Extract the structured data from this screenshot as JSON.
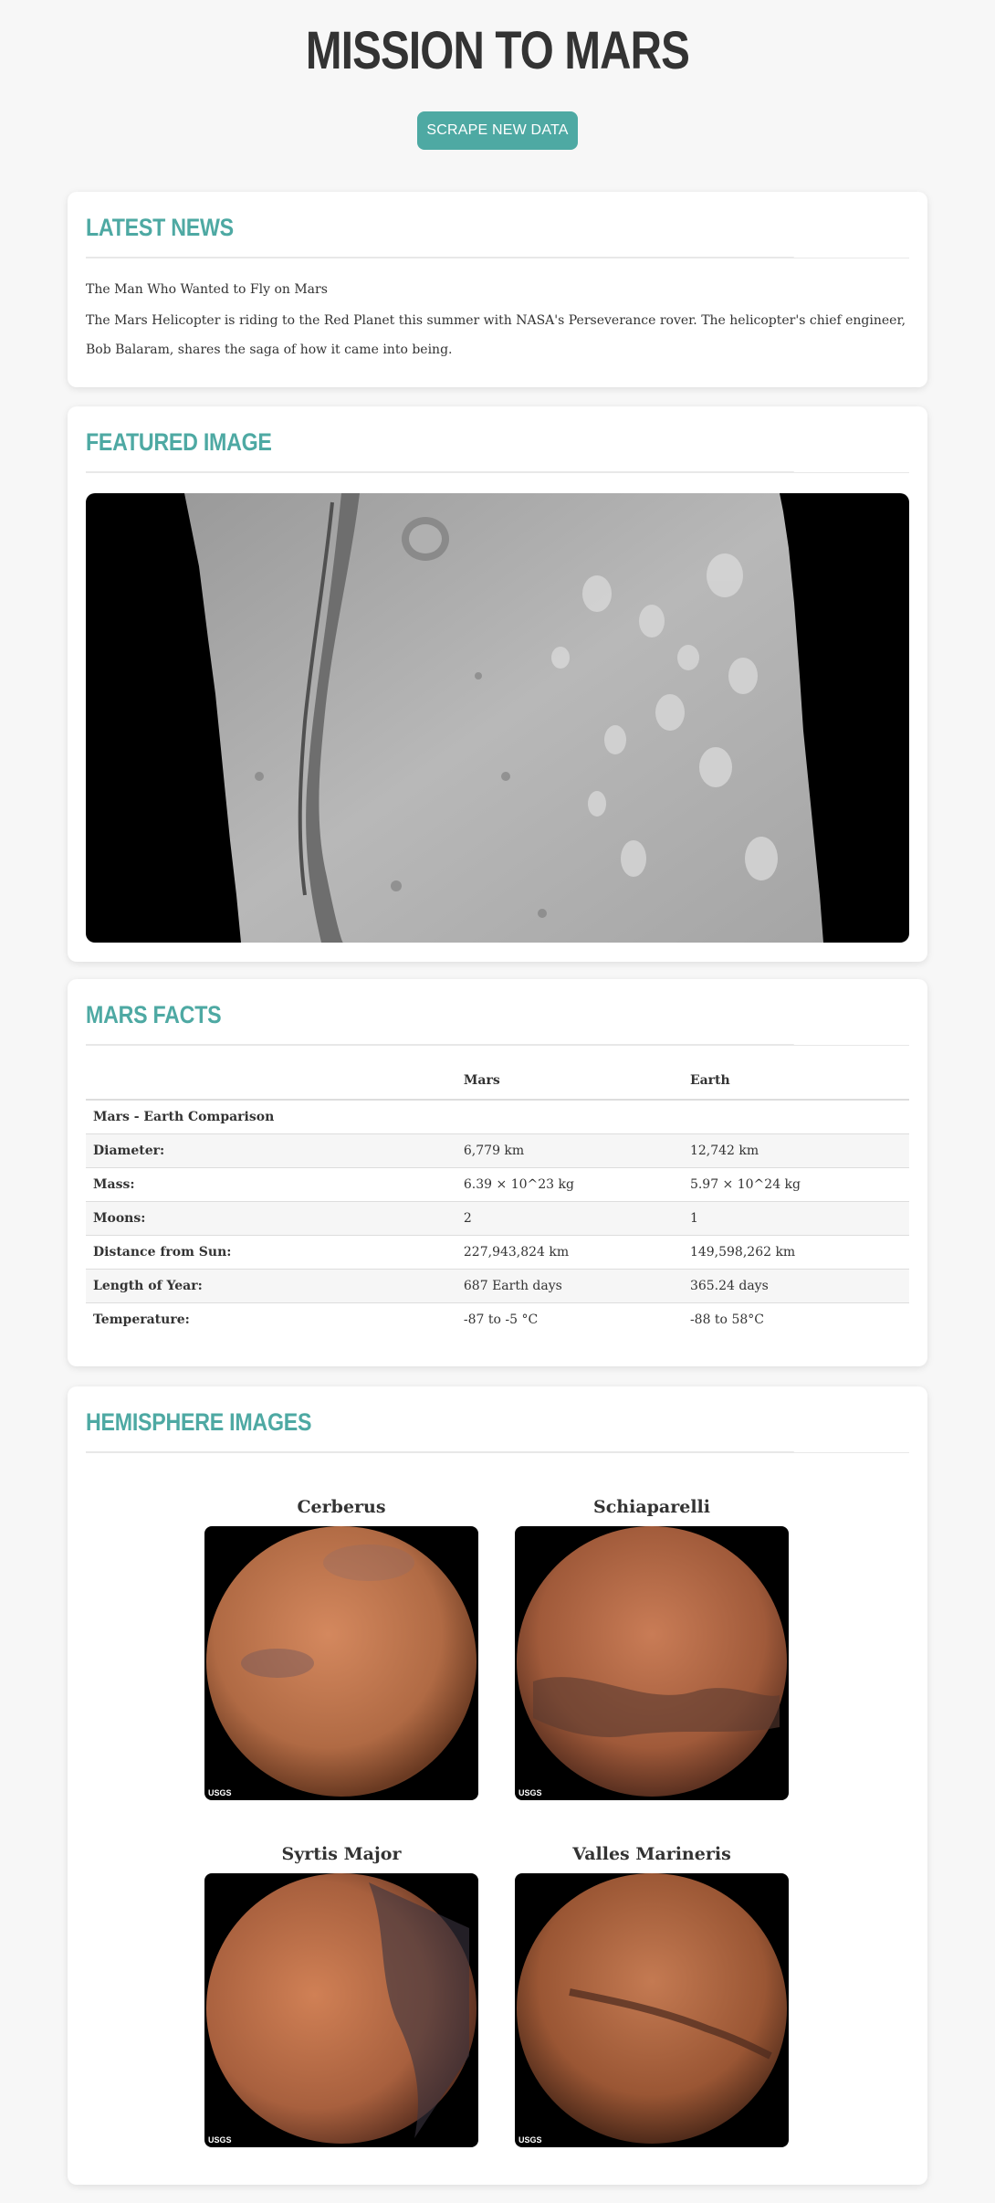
{
  "header": {
    "title": "MISSION TO MARS",
    "scrape_label": "SCRAPE NEW DATA"
  },
  "news": {
    "heading": "LATEST NEWS",
    "title": "The Man Who Wanted to Fly on Mars",
    "body": "The Mars Helicopter is riding to the Red Planet this summer with NASA's Perseverance rover. The helicopter's chief engineer, Bob Balaram, shares the saga of how it came into being."
  },
  "featured": {
    "heading": "FEATURED IMAGE"
  },
  "facts": {
    "heading": "MARS FACTS",
    "columns": [
      "",
      "Mars",
      "Earth"
    ],
    "caption": "Mars - Earth Comparison",
    "rows": [
      {
        "label": "Diameter:",
        "mars": "6,779 km",
        "earth": "12,742 km"
      },
      {
        "label": "Mass:",
        "mars": "6.39 × 10^23 kg",
        "earth": "5.97 × 10^24 kg"
      },
      {
        "label": "Moons:",
        "mars": "2",
        "earth": "1"
      },
      {
        "label": "Distance from Sun:",
        "mars": "227,943,824 km",
        "earth": "149,598,262 km"
      },
      {
        "label": "Length of Year:",
        "mars": "687 Earth days",
        "earth": "365.24 days"
      },
      {
        "label": "Temperature:",
        "mars": "-87 to -5 °C",
        "earth": "-88 to 58°C"
      }
    ]
  },
  "hemispheres": {
    "heading": "HEMISPHERE IMAGES",
    "items": [
      {
        "name": "Cerberus"
      },
      {
        "name": "Schiaparelli"
      },
      {
        "name": "Syrtis Major"
      },
      {
        "name": "Valles Marineris"
      }
    ],
    "logo_text": "USGS"
  }
}
